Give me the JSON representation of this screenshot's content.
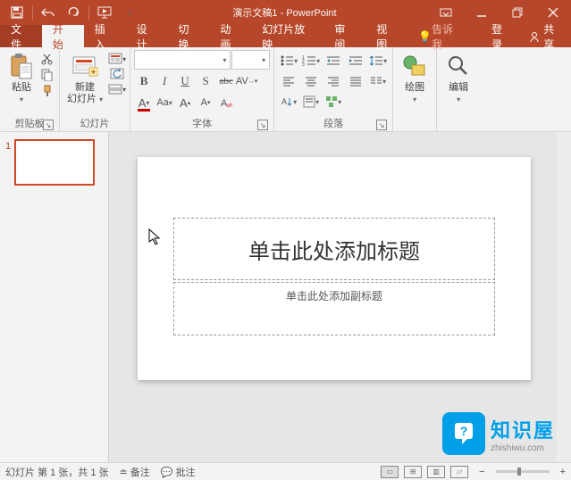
{
  "title": "演示文稿1 - PowerPoint",
  "tabs": {
    "file": "文件",
    "home": "开始",
    "insert": "插入",
    "design": "设计",
    "transition": "切换",
    "animation": "动画",
    "slideshow": "幻灯片放映",
    "review": "审阅",
    "view": "视图",
    "tell": "告诉我…",
    "login": "登录",
    "share": "共享"
  },
  "groups": {
    "clipboard": "剪贴板",
    "slides": "幻灯片",
    "font": "字体",
    "paragraph": "段落",
    "drawing": "绘图",
    "editing": "编辑"
  },
  "buttons": {
    "paste": "粘贴",
    "newslide1": "新建",
    "newslide2": "幻灯片"
  },
  "font": {
    "b": "B",
    "i": "I",
    "u": "U",
    "s": "S",
    "abc": "abc",
    "av": "AV",
    "aa": "Aa",
    "a_up": "A",
    "a_dn": "A",
    "a_color": "A"
  },
  "slide": {
    "title_ph": "单击此处添加标题",
    "sub_ph": "单击此处添加副标题",
    "thumb_num": "1"
  },
  "status": {
    "counter": "幻灯片 第 1 张，共 1 张",
    "notes": "备注",
    "comments": "批注"
  },
  "zoom": {
    "minus": "−",
    "plus": "+"
  },
  "badge": {
    "cn": "知识屋",
    "en": "zhishiwu.com"
  }
}
